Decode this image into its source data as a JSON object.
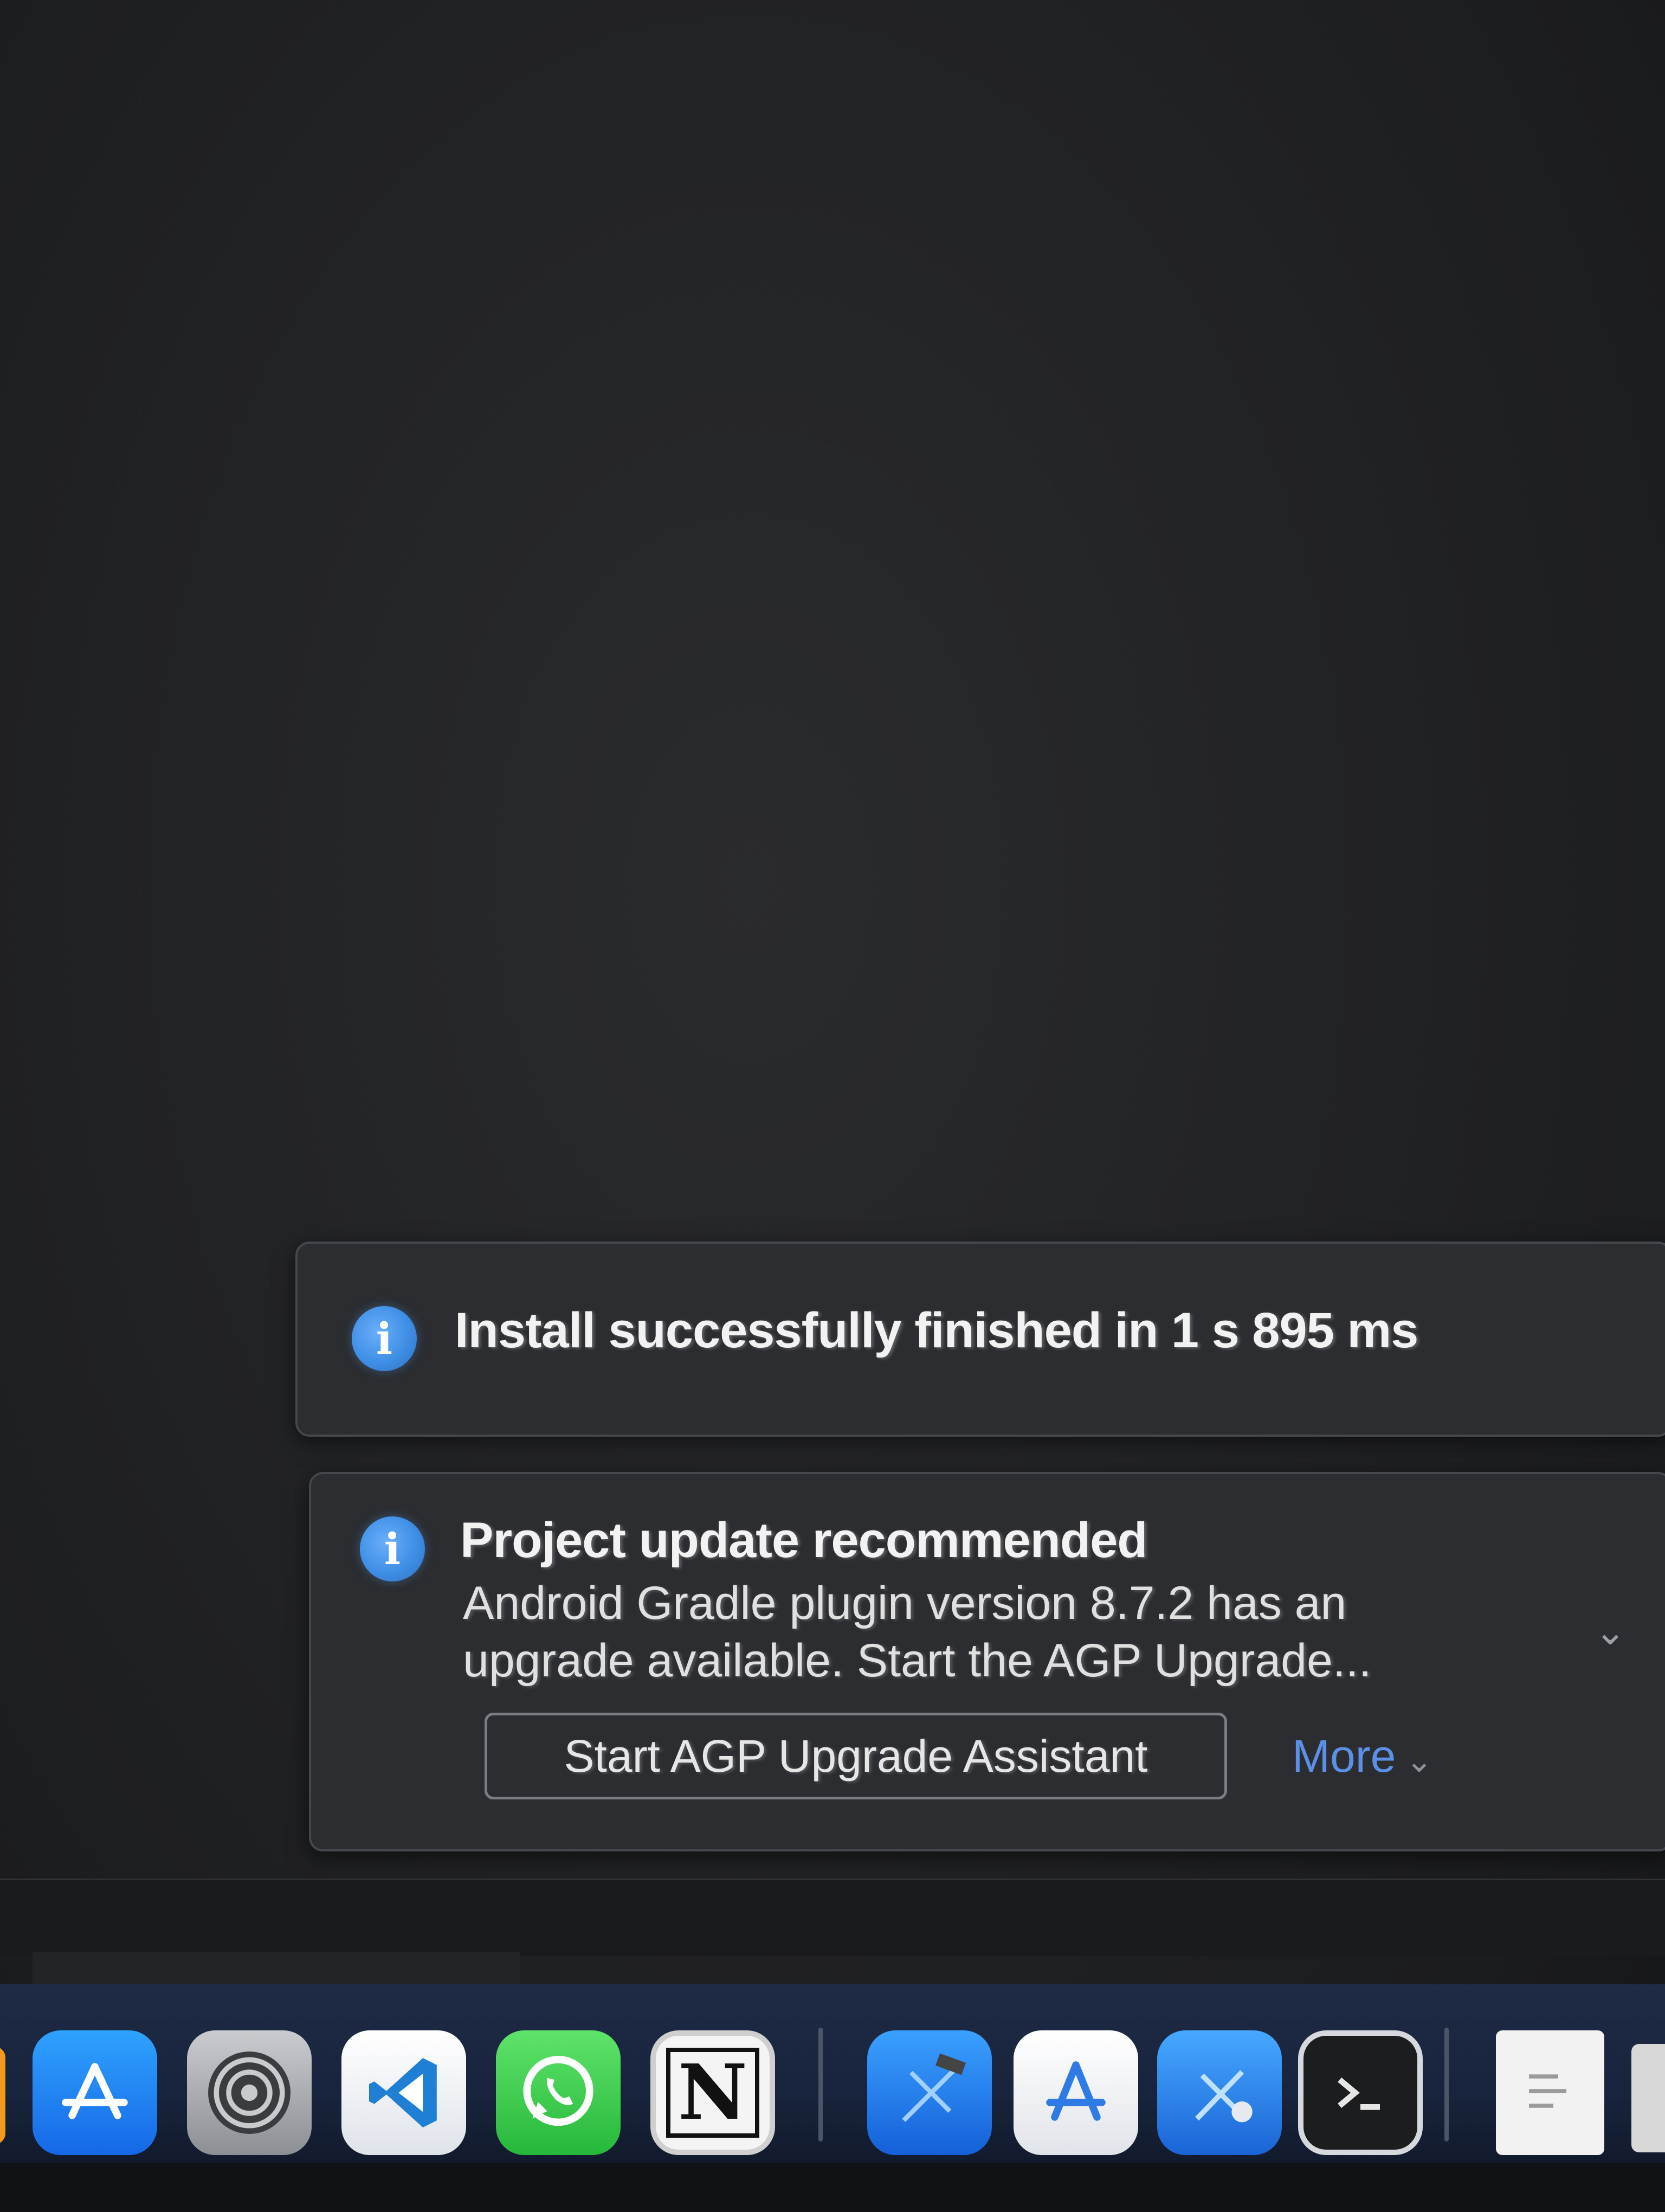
{
  "notifications": [
    {
      "title": "Install successfully finished in 1 s 895 ms"
    },
    {
      "title": "Project update recommended",
      "body_line1": "Android Gradle plugin version 8.7.2 has an",
      "body_line2": "upgrade available. Start the AGP Upgrade...",
      "action_label": "Start AGP Upgrade Assistant",
      "more_label": "More"
    }
  ],
  "dock": {
    "apps": [
      {
        "name": "App Store",
        "icon": "app-store-icon"
      },
      {
        "name": "System Settings",
        "icon": "settings-gear-icon"
      },
      {
        "name": "Visual Studio Code",
        "icon": "vscode-icon"
      },
      {
        "name": "WhatsApp",
        "icon": "whatsapp-icon"
      },
      {
        "name": "Notion",
        "icon": "notion-icon",
        "glyph": "N"
      },
      {
        "name": "Xcode",
        "icon": "xcode-icon"
      },
      {
        "name": "Instruments",
        "icon": "instruments-icon"
      },
      {
        "name": "Simulator",
        "icon": "simulator-icon"
      },
      {
        "name": "Terminal",
        "icon": "terminal-icon"
      },
      {
        "name": "Notes",
        "icon": "notes-icon"
      }
    ]
  },
  "colors": {
    "accent_blue": "#3f8fe6",
    "link_blue": "#5b8fe8",
    "card_bg": "#2b2d30",
    "card_border": "#44474c",
    "dock_bg": "#1f2a44"
  }
}
